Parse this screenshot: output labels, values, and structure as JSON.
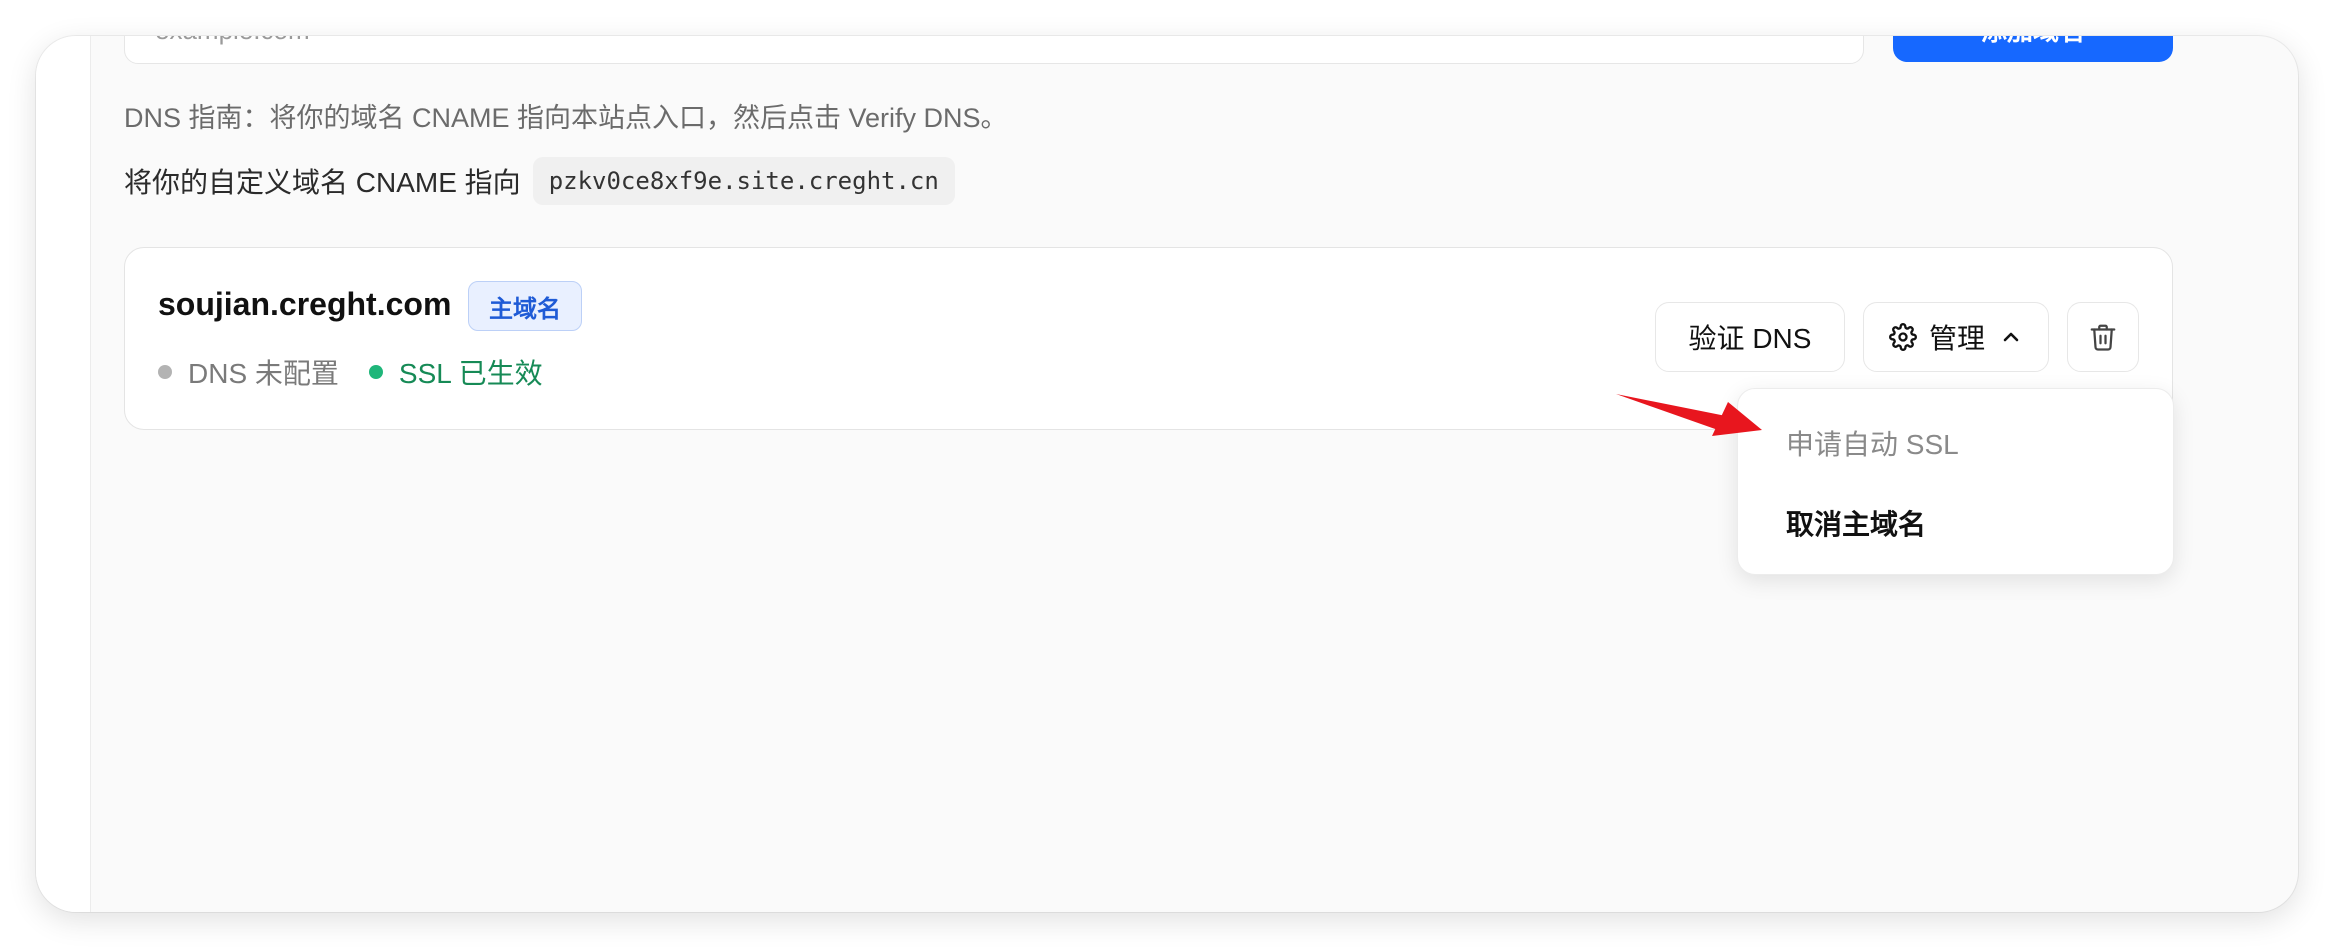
{
  "add_domain": {
    "input_placeholder": "example.com",
    "button_label": "添加域名"
  },
  "dns_guide": "DNS 指南：将你的域名 CNAME 指向本站点入口，然后点击 Verify DNS。",
  "cname": {
    "label": "将你的自定义域名 CNAME 指向",
    "target": "pzkv0ce8xf9e.site.creght.cn"
  },
  "domain": {
    "name": "soujian.creght.com",
    "badge": "主域名",
    "dns_status": "DNS 未配置",
    "ssl_status": "SSL 已生效"
  },
  "actions": {
    "verify_dns": "验证 DNS",
    "manage": "管理"
  },
  "manage_menu": [
    {
      "label": "申请自动 SSL",
      "disabled": true
    },
    {
      "label": "取消主域名",
      "disabled": false
    }
  ],
  "colors": {
    "accent": "#1668ff",
    "ssl_active": "#1fb67a",
    "dns_unconfigured": "#b3b3b3",
    "annotation_arrow": "#e8161e"
  }
}
